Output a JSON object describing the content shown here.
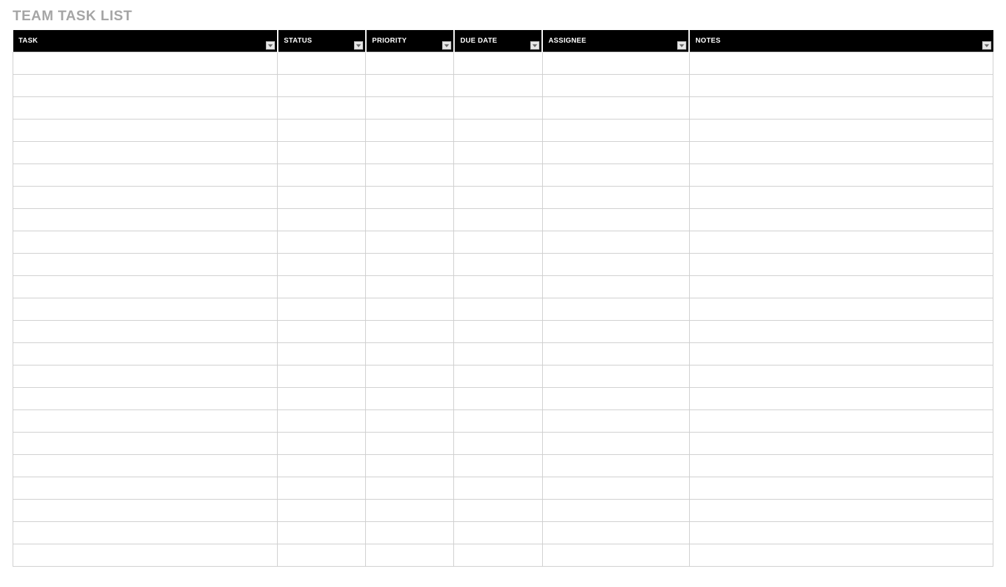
{
  "title": "TEAM TASK LIST",
  "columns": [
    {
      "label": "TASK",
      "key": "task",
      "filter": true
    },
    {
      "label": "STATUS",
      "key": "status",
      "filter": true
    },
    {
      "label": "PRIORITY",
      "key": "priority",
      "filter": true
    },
    {
      "label": "DUE DATE",
      "key": "duedate",
      "filter": true
    },
    {
      "label": "ASSIGNEE",
      "key": "assignee",
      "filter": true
    },
    {
      "label": "NOTES",
      "key": "notes",
      "filter": true
    }
  ],
  "rows": [
    {
      "task": "",
      "status": "",
      "priority": "",
      "duedate": "",
      "assignee": "",
      "notes": ""
    },
    {
      "task": "",
      "status": "",
      "priority": "",
      "duedate": "",
      "assignee": "",
      "notes": ""
    },
    {
      "task": "",
      "status": "",
      "priority": "",
      "duedate": "",
      "assignee": "",
      "notes": ""
    },
    {
      "task": "",
      "status": "",
      "priority": "",
      "duedate": "",
      "assignee": "",
      "notes": ""
    },
    {
      "task": "",
      "status": "",
      "priority": "",
      "duedate": "",
      "assignee": "",
      "notes": ""
    },
    {
      "task": "",
      "status": "",
      "priority": "",
      "duedate": "",
      "assignee": "",
      "notes": ""
    },
    {
      "task": "",
      "status": "",
      "priority": "",
      "duedate": "",
      "assignee": "",
      "notes": ""
    },
    {
      "task": "",
      "status": "",
      "priority": "",
      "duedate": "",
      "assignee": "",
      "notes": ""
    },
    {
      "task": "",
      "status": "",
      "priority": "",
      "duedate": "",
      "assignee": "",
      "notes": ""
    },
    {
      "task": "",
      "status": "",
      "priority": "",
      "duedate": "",
      "assignee": "",
      "notes": ""
    },
    {
      "task": "",
      "status": "",
      "priority": "",
      "duedate": "",
      "assignee": "",
      "notes": ""
    },
    {
      "task": "",
      "status": "",
      "priority": "",
      "duedate": "",
      "assignee": "",
      "notes": ""
    },
    {
      "task": "",
      "status": "",
      "priority": "",
      "duedate": "",
      "assignee": "",
      "notes": ""
    },
    {
      "task": "",
      "status": "",
      "priority": "",
      "duedate": "",
      "assignee": "",
      "notes": ""
    },
    {
      "task": "",
      "status": "",
      "priority": "",
      "duedate": "",
      "assignee": "",
      "notes": ""
    },
    {
      "task": "",
      "status": "",
      "priority": "",
      "duedate": "",
      "assignee": "",
      "notes": ""
    },
    {
      "task": "",
      "status": "",
      "priority": "",
      "duedate": "",
      "assignee": "",
      "notes": ""
    },
    {
      "task": "",
      "status": "",
      "priority": "",
      "duedate": "",
      "assignee": "",
      "notes": ""
    },
    {
      "task": "",
      "status": "",
      "priority": "",
      "duedate": "",
      "assignee": "",
      "notes": ""
    },
    {
      "task": "",
      "status": "",
      "priority": "",
      "duedate": "",
      "assignee": "",
      "notes": ""
    },
    {
      "task": "",
      "status": "",
      "priority": "",
      "duedate": "",
      "assignee": "",
      "notes": ""
    },
    {
      "task": "",
      "status": "",
      "priority": "",
      "duedate": "",
      "assignee": "",
      "notes": ""
    },
    {
      "task": "",
      "status": "",
      "priority": "",
      "duedate": "",
      "assignee": "",
      "notes": ""
    }
  ]
}
